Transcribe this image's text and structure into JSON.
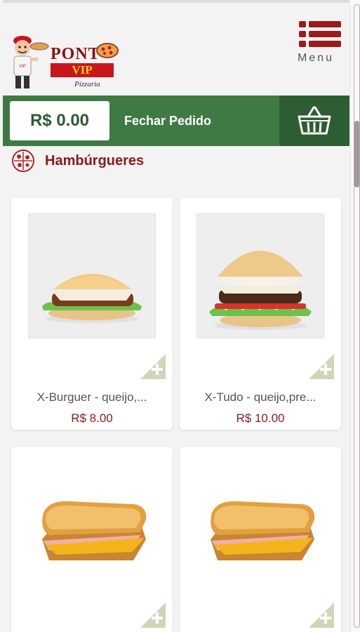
{
  "brand": {
    "name": "PONT",
    "tag": "VIP",
    "sub": "Pizzaria"
  },
  "menu": {
    "label": "Menu"
  },
  "order": {
    "total": "R$ 0.00",
    "close_label": "Fechar Pedido"
  },
  "section": {
    "title": "Hambúrgueres"
  },
  "products": [
    {
      "name": "X-Burguer - queijo,...",
      "price": "R$ 8.00",
      "image": "burger"
    },
    {
      "name": "X-Tudo - queijo,pre...",
      "price": "R$ 10.00",
      "image": "burger-deluxe"
    },
    {
      "name": "",
      "price": "",
      "image": "toast-sandwich"
    },
    {
      "name": "",
      "price": "",
      "image": "toast-sandwich"
    }
  ],
  "colors": {
    "accent": "#3f7a45",
    "accent_dark": "#2d5d32",
    "brand_red": "#8b1a1a"
  }
}
